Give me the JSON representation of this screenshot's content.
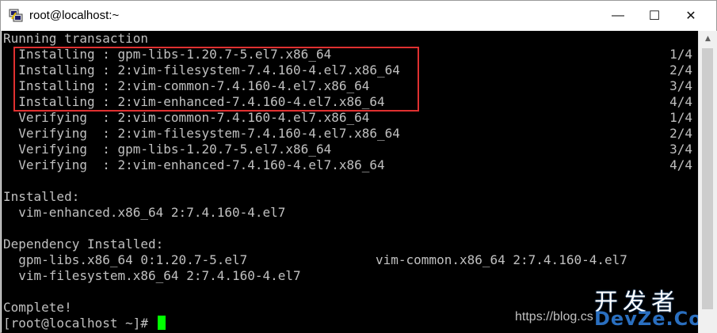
{
  "window": {
    "title": "root@localhost:~",
    "minimize_glyph": "—",
    "maximize_glyph": "☐",
    "close_glyph": "✕"
  },
  "terminal": {
    "lines": [
      "Running transaction",
      "  Installing : gpm-libs-1.20.7-5.el7.x86_64",
      "  Installing : 2:vim-filesystem-7.4.160-4.el7.x86_64",
      "  Installing : 2:vim-common-7.4.160-4.el7.x86_64",
      "  Installing : 2:vim-enhanced-7.4.160-4.el7.x86_64",
      "  Verifying  : 2:vim-common-7.4.160-4.el7.x86_64",
      "  Verifying  : 2:vim-filesystem-7.4.160-4.el7.x86_64",
      "  Verifying  : gpm-libs-1.20.7-5.el7.x86_64",
      "  Verifying  : 2:vim-enhanced-7.4.160-4.el7.x86_64",
      "",
      "Installed:",
      "  vim-enhanced.x86_64 2:7.4.160-4.el7",
      "",
      "Dependency Installed:",
      "  gpm-libs.x86_64 0:1.20.7-5.el7",
      "  vim-filesystem.x86_64 2:7.4.160-4.el7",
      "",
      "Complete!",
      "[root@localhost ~]# "
    ],
    "counters": [
      "1/4",
      "2/4",
      "3/4",
      "4/4",
      "1/4",
      "2/4",
      "3/4",
      "4/4"
    ],
    "dependency_col2": "vim-common.x86_64 2:7.4.160-4.el7"
  },
  "watermark": {
    "url": "https://blog.cs",
    "logo_cn": "开发者",
    "logo_en": "DevZe.CoM"
  },
  "colors": {
    "terminal_bg": "#000000",
    "terminal_fg": "#c0c0c0",
    "cursor": "#00ff00",
    "highlight": "#e03030"
  }
}
